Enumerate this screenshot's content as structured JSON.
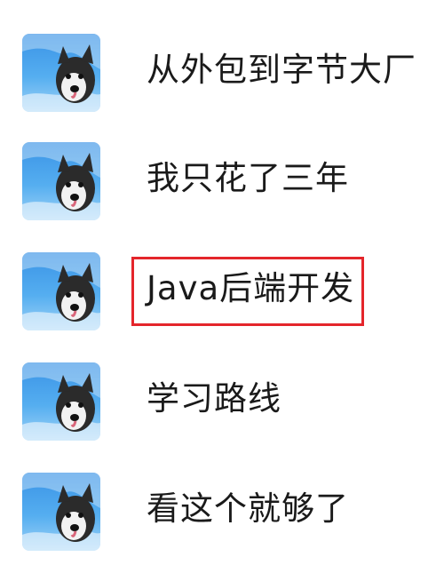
{
  "contacts": [
    {
      "name": "从外包到字节大厂",
      "avatar_icon": "husky-dog-avatar-icon"
    },
    {
      "name": "我只花了三年",
      "avatar_icon": "husky-dog-avatar-icon"
    },
    {
      "name": "Java后端开发",
      "avatar_icon": "husky-dog-avatar-icon",
      "highlighted": true,
      "highlight_color": "#e4252b"
    },
    {
      "name": "学习路线",
      "avatar_icon": "husky-dog-avatar-icon"
    },
    {
      "name": "看这个就够了",
      "avatar_icon": "husky-dog-avatar-icon"
    }
  ]
}
